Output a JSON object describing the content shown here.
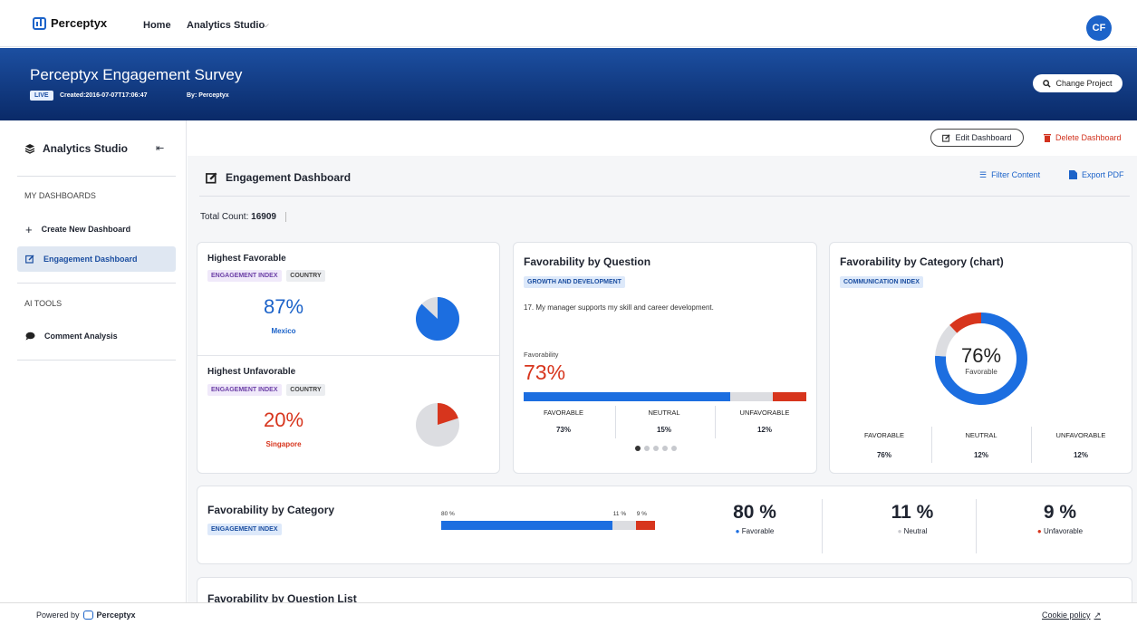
{
  "topnav": {
    "brand": "Perceptyx",
    "home": "Home",
    "studio": "Analytics Studio",
    "avatar": "CF"
  },
  "hero": {
    "title": "Perceptyx Engagement Survey",
    "live": "LIVE",
    "created": "Created:2016-07-07T17:06:47",
    "by": "By: Perceptyx",
    "change_project": "Change Project"
  },
  "sidebar": {
    "title": "Analytics Studio",
    "my_dashboards": "MY DASHBOARDS",
    "create": "Create New Dashboard",
    "engagement": "Engagement Dashboard",
    "ai_tools": "AI TOOLS",
    "comment": "Comment Analysis"
  },
  "toolbar": {
    "edit": "Edit Dashboard",
    "delete": "Delete Dashboard",
    "filter": "Filter Content",
    "export": "Export PDF"
  },
  "dashboard": {
    "title": "Engagement Dashboard",
    "total_label": "Total Count:",
    "total_value": "16909"
  },
  "highest_favorable": {
    "title": "Highest Favorable",
    "tag1": "ENGAGEMENT INDEX",
    "tag2": "COUNTRY",
    "pct": "87%",
    "place": "Mexico",
    "fraction": 0.87
  },
  "highest_unfavorable": {
    "title": "Highest Unfavorable",
    "tag1": "ENGAGEMENT INDEX",
    "tag2": "COUNTRY",
    "pct": "20%",
    "place": "Singapore",
    "fraction": 0.2
  },
  "fav_question": {
    "title": "Favorability by Question",
    "tag": "GROWTH AND DEVELOPMENT",
    "question": "17. My manager supports my skill and career development.",
    "fav_label": "Favorability",
    "fav_pct": "73%",
    "cols": [
      {
        "label": "FAVORABLE",
        "value": "73%"
      },
      {
        "label": "NEUTRAL",
        "value": "15%"
      },
      {
        "label": "UNFAVORABLE",
        "value": "12%"
      }
    ],
    "bar": [
      73,
      15,
      12
    ]
  },
  "fav_category_chart": {
    "title": "Favorability by Category (chart)",
    "tag": "COMMUNICATION INDEX",
    "center_pct": "76%",
    "center_label": "Favorable",
    "cols": [
      {
        "label": "FAVORABLE",
        "value": "76%"
      },
      {
        "label": "NEUTRAL",
        "value": "12%"
      },
      {
        "label": "UNFAVORABLE",
        "value": "12%"
      }
    ],
    "donut": [
      76,
      12,
      12
    ]
  },
  "fav_category": {
    "title": "Favorability by Category",
    "tag": "ENGAGEMENT INDEX",
    "bar_labels": [
      "80 %",
      "11 %",
      "9 %"
    ],
    "bar": [
      80,
      11,
      9
    ],
    "stats": [
      {
        "value": "80 %",
        "label": "Favorable"
      },
      {
        "value": "11 %",
        "label": "Neutral"
      },
      {
        "value": "9 %",
        "label": "Unfavorable"
      }
    ]
  },
  "fav_question_list": {
    "title": "Favorability by Question List"
  },
  "colors": {
    "favorable": "#1c6ee0",
    "neutral": "#dcdde1",
    "unfavorable": "#d7351d",
    "brand": "#1c63c9"
  },
  "footer": {
    "powered": "Powered by",
    "brand": "Perceptyx",
    "cookie": "Cookie policy"
  }
}
